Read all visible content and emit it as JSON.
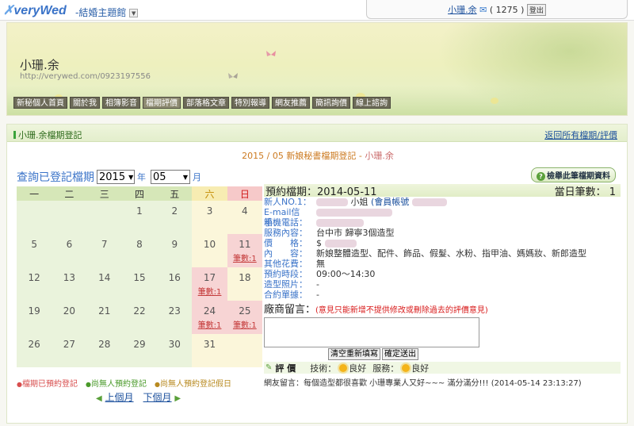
{
  "topbar": {
    "logo": "veryWed",
    "site_link": "-結婚主題館",
    "user_name": "小珊.余",
    "mail_count": "( 1275 )",
    "logout_label": "登出"
  },
  "banner": {
    "title": "小珊.余",
    "url": "http://verywed.com/0923197556",
    "nav": [
      "新秘個人首頁",
      "關於我",
      "相簿影音",
      "檔期評價",
      "部落格文章",
      "特別報導",
      "網友推薦",
      "簡訊詢價",
      "線上諮詢"
    ]
  },
  "panel": {
    "title": "小珊.余檔期登記",
    "back_link": "返回所有檔期/評價",
    "month_title_prefix": "2015 / 05 新娘秘書檔期登記 - ",
    "month_title_who": "小珊.余",
    "query_label": "查詢已登記檔期",
    "year_value": "2015",
    "year_unit": "年",
    "month_value": "05",
    "month_unit": "月",
    "report_button": "檢舉此筆檔期資料"
  },
  "calendar": {
    "weekdays": [
      "一",
      "二",
      "三",
      "四",
      "五",
      "六",
      "日"
    ],
    "weeks": [
      [
        {
          "d": ""
        },
        {
          "d": ""
        },
        {
          "d": ""
        },
        {
          "d": "1"
        },
        {
          "d": "2"
        },
        {
          "d": "3"
        },
        {
          "d": "4"
        }
      ],
      [
        {
          "d": "5"
        },
        {
          "d": "6"
        },
        {
          "d": "7"
        },
        {
          "d": "8"
        },
        {
          "d": "9"
        },
        {
          "d": "10"
        },
        {
          "d": "11",
          "c": "筆數:1"
        }
      ],
      [
        {
          "d": "12"
        },
        {
          "d": "13"
        },
        {
          "d": "14"
        },
        {
          "d": "15"
        },
        {
          "d": "16"
        },
        {
          "d": "17",
          "c": "筆數:1"
        },
        {
          "d": "18"
        }
      ],
      [
        {
          "d": "19"
        },
        {
          "d": "20"
        },
        {
          "d": "21"
        },
        {
          "d": "22"
        },
        {
          "d": "23"
        },
        {
          "d": "24",
          "c": "筆數:1"
        },
        {
          "d": "25",
          "c": "筆數:1"
        }
      ],
      [
        {
          "d": "26"
        },
        {
          "d": "27"
        },
        {
          "d": "28"
        },
        {
          "d": "29"
        },
        {
          "d": "30"
        },
        {
          "d": "31"
        },
        {
          "d": ""
        }
      ]
    ],
    "legend": [
      "檔期已預約登記",
      "尚無人預約登記",
      "尚無人預約登記假日"
    ],
    "prev_month": "上個月",
    "next_month": "下個月"
  },
  "detail": {
    "date": "預約檔期：2014-05-11",
    "count": "當日筆數： 1",
    "rows": [
      {
        "k": "新人NO.1：",
        "v": "小姐",
        "acct": "(會員帳號"
      },
      {
        "k": "E-mail信箱：",
        "v": ""
      },
      {
        "k": "手機電話：",
        "v": ""
      },
      {
        "k": "服務內容：",
        "v": "台中市 歸寧3個造型"
      },
      {
        "k": "價　　格：",
        "v": "$"
      },
      {
        "k": "內　　容：",
        "v": "新娘整體造型、配件、飾品、假髮、水粉、指甲油、媽媽妝、新郎造型"
      },
      {
        "k": "其他花費：",
        "v": "無"
      },
      {
        "k": "預約時段：",
        "v": "09:00～14:30"
      },
      {
        "k": "造型照片：",
        "v": "-"
      },
      {
        "k": "合約單據：",
        "v": "-"
      }
    ],
    "message_label": "廠商留言：",
    "message_note": "(意見只能新增不提供修改或刪除過去的評價意見)",
    "clear_button": "清空重新填寫",
    "submit_button": "確定送出",
    "rating_title": "評 價",
    "tech_label": "技術：",
    "tech_value": "良好",
    "service_label": "服務：",
    "service_value": "良好",
    "review": "網友留言：每個造型都很喜歡 小珊專業人又好~~~ 滿分滿分!!!  (2014-05-14 23:13:27)"
  }
}
